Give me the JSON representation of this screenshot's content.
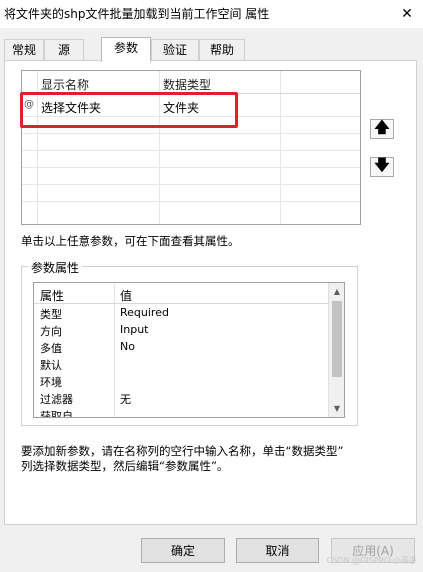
{
  "window": {
    "title": "将文件夹的shp文件批量加载到当前工作空间 属性",
    "close_glyph": "✕"
  },
  "tabs": [
    {
      "label": "常规",
      "active": false
    },
    {
      "label": "源",
      "active": false
    },
    {
      "label": "参数",
      "active": true
    },
    {
      "label": "验证",
      "active": false
    },
    {
      "label": "帮助",
      "active": false
    }
  ],
  "param_table": {
    "col_display_name": "显示名称",
    "col_data_type": "数据类型",
    "rows": [
      {
        "marker": "@",
        "display_name": "选择文件夹",
        "data_type": "文件夹",
        "highlighted": true
      }
    ],
    "highlight_color": "#e0202a"
  },
  "move_buttons": {
    "up_icon": "up-arrow-icon",
    "up_glyph": "🡅",
    "down_icon": "down-arrow-icon",
    "down_glyph": "🡇"
  },
  "hint_click": "单击以上任意参数，可在下面查看其属性。",
  "param_props": {
    "legend": "参数属性",
    "header": {
      "key": "属性",
      "value": "值"
    },
    "rows": [
      {
        "key": "类型",
        "value": "Required"
      },
      {
        "key": "方向",
        "value": "Input"
      },
      {
        "key": "多值",
        "value": "No"
      },
      {
        "key": "默认",
        "value": ""
      },
      {
        "key": "环境",
        "value": ""
      },
      {
        "key": "过滤器",
        "value": "无"
      },
      {
        "key": "获取自",
        "value": ""
      }
    ],
    "scroll_up_glyph": "▲",
    "scroll_down_glyph": "▼"
  },
  "hint_add": {
    "line1": "要添加新参数，请在名称列的空行中输入名称，单击“数据类型”",
    "line2": "列选择数据类型，然后编辑“参数属性”。"
  },
  "buttons": {
    "ok": "确定",
    "cancel": "取消",
    "apply": "应用(A)"
  },
  "watermark": "CSDN @GISPRO·小青手"
}
